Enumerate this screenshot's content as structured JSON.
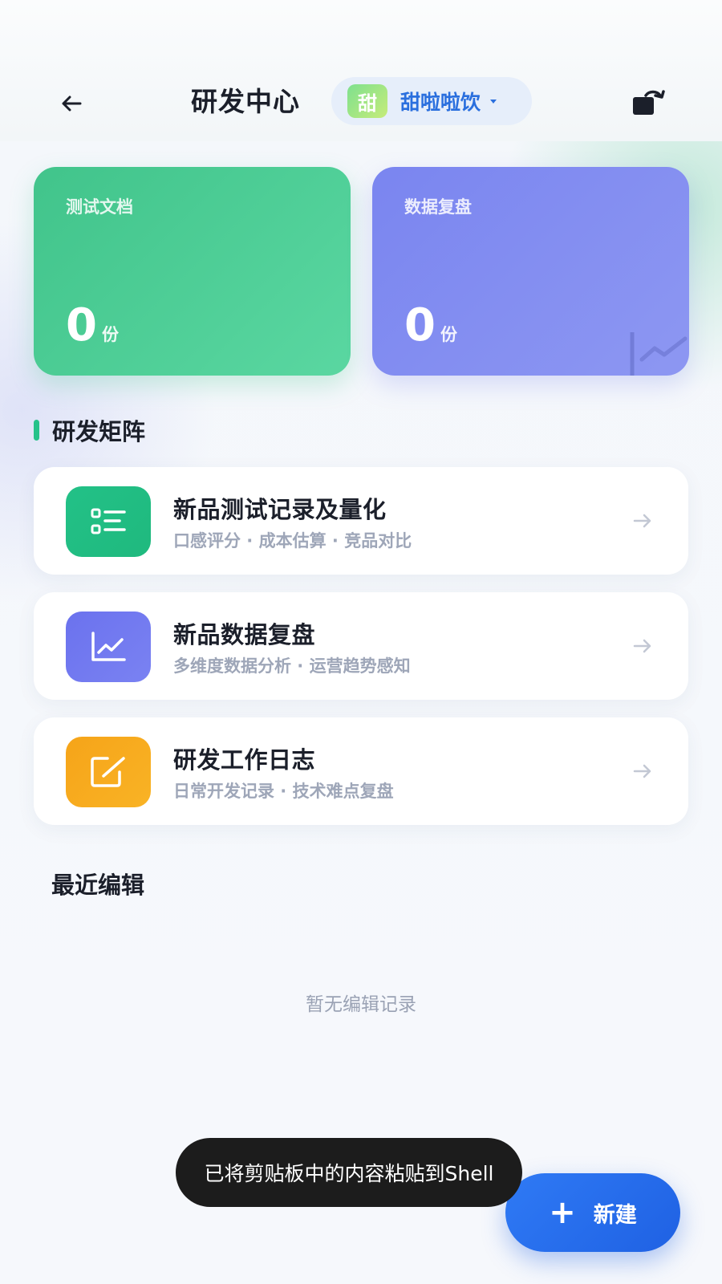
{
  "header": {
    "title": "研发中心",
    "brand": {
      "avatar_char": "甜",
      "name": "甜啦啦饮"
    },
    "back_icon": "arrow-left-icon",
    "switch_icon": "switch-account-icon"
  },
  "stats": [
    {
      "label": "测试文档",
      "value": "0",
      "unit": "份",
      "color": "#4fcf97"
    },
    {
      "label": "数据复盘",
      "value": "0",
      "unit": "份",
      "color": "#8590f1"
    }
  ],
  "section": {
    "title": "研发矩阵",
    "accent": "#26c28a"
  },
  "features": [
    {
      "title": "新品测试记录及量化",
      "subtitle": "口感评分 · 成本估算 · 竞品对比",
      "icon": "list-icon",
      "color": "#22be84"
    },
    {
      "title": "新品数据复盘",
      "subtitle": "多维度数据分析 · 运营趋势感知",
      "icon": "trend-chart-icon",
      "color": "#7078ef"
    },
    {
      "title": "研发工作日志",
      "subtitle": "日常开发记录 · 技术难点复盘",
      "icon": "edit-note-icon",
      "color": "#f7aa1d"
    }
  ],
  "recent": {
    "title": "最近编辑",
    "empty": "暂无编辑记录"
  },
  "fab": {
    "label": "新建",
    "color": "#2a70ee"
  },
  "toast": {
    "text": "已将剪贴板中的内容粘贴到Shell"
  }
}
